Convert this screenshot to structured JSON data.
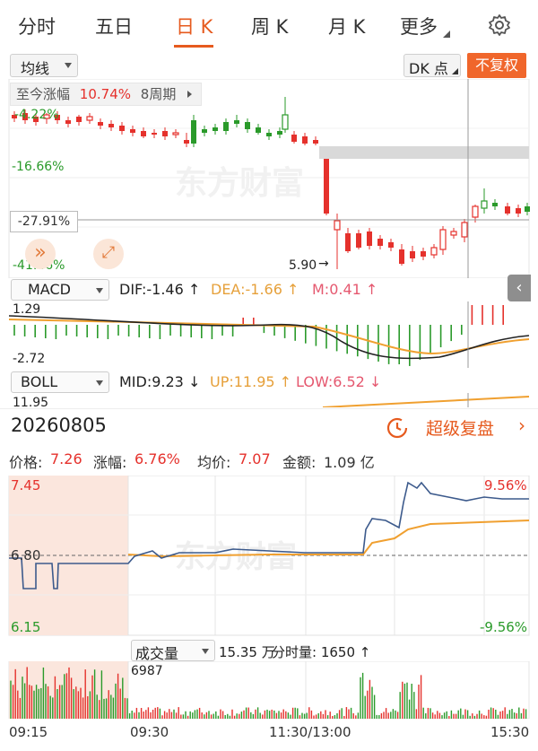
{
  "tabs": [
    {
      "label": "分时",
      "active": false
    },
    {
      "label": "五日",
      "active": false
    },
    {
      "label": "日 K",
      "active": true
    },
    {
      "label": "周 K",
      "active": false
    },
    {
      "label": "月 K",
      "active": false
    },
    {
      "label": "更多",
      "active": false
    }
  ],
  "toolbar": {
    "ma_select": "均线",
    "dk_select": "DK 点",
    "fq_button": "不复权"
  },
  "kline": {
    "range_label": "至今涨幅",
    "range_pct": "10.74%",
    "range_period": "8周期",
    "labels": {
      "top": "-4.22%",
      "mid1": "-16.66%",
      "cursor": "-27.91%",
      "bottom": "-41.46%",
      "low_price": "5.90",
      "watermark": "东方财富"
    }
  },
  "macd": {
    "name": "MACD",
    "dif": "DIF:-1.46",
    "dea": "DEA:-1.66",
    "m": "M:0.41",
    "top": "1.29",
    "bottom": "-2.72"
  },
  "boll": {
    "name": "BOLL",
    "mid": "MID:9.23",
    "up": "UP:11.95",
    "low": "LOW:6.52",
    "top": "11.95"
  },
  "detail": {
    "date": "20260805",
    "replay_label": "超级复盘",
    "price_label": "价格:",
    "price": "7.26",
    "change_label": "涨幅:",
    "change": "6.76%",
    "avg_label": "均价:",
    "avg": "7.07",
    "amount_label": "金额:",
    "amount": "1.09 亿"
  },
  "intraday": {
    "y_top": "7.45",
    "y_mid": "6.80",
    "y_bottom": "6.15",
    "pct_top": "9.56%",
    "pct_bottom": "-9.56%",
    "watermark": "东方财富"
  },
  "volume": {
    "select": "成交量",
    "total": "15.35 万",
    "timeshare_label": "分时量:",
    "timeshare": "1650",
    "max_label": "6987",
    "times": [
      "09:15",
      "09:30",
      "11:30/13:00",
      "15:30"
    ]
  },
  "colors": {
    "accent": "#e65a1e",
    "up": "#e5312c",
    "down": "#2a9a2a",
    "avg_line": "#f0a030",
    "price_line": "#3c5a8c"
  }
}
